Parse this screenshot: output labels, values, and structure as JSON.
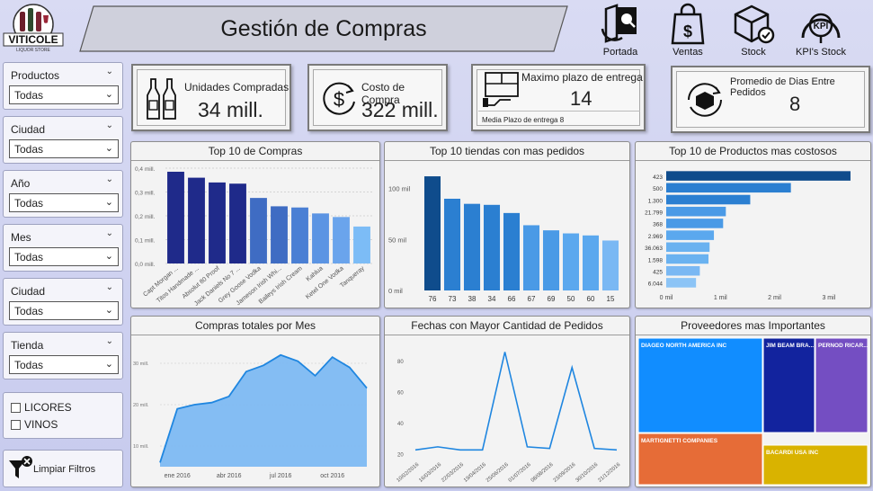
{
  "header": {
    "logo_text": "VITICOLE",
    "logo_sub": "LIQUOR STORE",
    "title": "Gestión de Compras",
    "nav": [
      {
        "label": "Portada",
        "icon": "portada-icon"
      },
      {
        "label": "Ventas",
        "icon": "shopping-bag-dollar-icon"
      },
      {
        "label": "Stock",
        "icon": "stock-box-icon"
      },
      {
        "label": "KPI's Stock",
        "icon": "kpi-gauge-icon"
      }
    ]
  },
  "filters": [
    {
      "label": "Productos",
      "value": "Todas"
    },
    {
      "label": "Ciudad",
      "value": "Todas"
    },
    {
      "label": "Año",
      "value": "Todas"
    },
    {
      "label": "Mes",
      "value": "Todas"
    },
    {
      "label": "Ciudad",
      "value": "Todas"
    },
    {
      "label": "Tienda",
      "value": "Todas"
    }
  ],
  "checkboxes": [
    {
      "label": "LICORES",
      "checked": false
    },
    {
      "label": "VINOS",
      "checked": false
    }
  ],
  "clear_filters": "Limpiar Filtros",
  "kpis": {
    "units": {
      "label": "Unidades Compradas",
      "value": "34 mill."
    },
    "cost": {
      "label": "Costo de Compra",
      "value": "322 mill."
    },
    "max_term": {
      "label": "Maximo plazo de entrega",
      "value": "14",
      "sub": "Media Plazo de entrega 8"
    },
    "avg_days": {
      "label": "Promedio de Dias Entre Pedidos",
      "value": "8"
    }
  },
  "panels": {
    "top_compras": "Top 10 de Compras",
    "top_tiendas": "Top 10 tiendas con mas pedidos",
    "top_productos": "Top 10 de Productos mas costosos",
    "compras_mes": "Compras totales por Mes",
    "fechas": "Fechas con Mayor Cantidad de Pedidos",
    "proveedores": "Proveedores mas Importantes"
  },
  "chart_data": [
    {
      "type": "bar",
      "title": "Top 10 de Compras",
      "categories": [
        "Capt Morgan ...",
        "Titos Handmade ...",
        "Absolut 80 Proof",
        "Jack Daniels No 7 ...",
        "Grey Goose Vodka",
        "Jameson Irish Whi...",
        "Baileys Irish Cream",
        "Kahlua",
        "Ketel One Vodka",
        "Tanqueray"
      ],
      "values": [
        0.385,
        0.36,
        0.34,
        0.335,
        0.275,
        0.24,
        0.235,
        0.21,
        0.195,
        0.155
      ],
      "ylim": [
        0,
        0.4
      ],
      "yticks": [
        "0,0 mill.",
        "0,1 mill.",
        "0,2 mill.",
        "0,3 mill.",
        "0,4 mill."
      ],
      "colors": [
        "#1f2a8a",
        "#1f2a8a",
        "#1f2a8a",
        "#1f2a8a",
        "#3f6cc3",
        "#3f6cc3",
        "#4a7fd4",
        "#5b94e3",
        "#6aa4ec",
        "#7cbcf6"
      ]
    },
    {
      "type": "bar",
      "title": "Top 10 tiendas con mas pedidos",
      "categories": [
        "76",
        "73",
        "38",
        "34",
        "66",
        "67",
        "69",
        "50",
        "60",
        "15"
      ],
      "values": [
        112,
        90,
        85,
        84,
        76,
        64,
        59,
        56,
        54,
        49
      ],
      "ylim": [
        0,
        120
      ],
      "yticks": [
        "0 mil",
        "50 mil",
        "100 mil"
      ],
      "colors": [
        "#0f4c8c",
        "#2b7fd1",
        "#2b7fd1",
        "#2b7fd1",
        "#2b7fd1",
        "#4a9ae6",
        "#4a9ae6",
        "#5ba8ee",
        "#5ba8ee",
        "#7ab8f3"
      ]
    },
    {
      "type": "bar",
      "orientation": "horizontal",
      "title": "Top 10 de Productos mas costosos",
      "categories": [
        "423",
        "500",
        "1.300",
        "21.799",
        "368",
        "2.969",
        "36.063",
        "1.598",
        "425",
        "6.044"
      ],
      "values": [
        3.4,
        2.3,
        1.55,
        1.1,
        1.05,
        0.88,
        0.8,
        0.78,
        0.62,
        0.55
      ],
      "xlim": [
        0,
        3.5
      ],
      "xticks": [
        "0 mil",
        "1 mil",
        "2 mil",
        "3 mil"
      ],
      "colors": [
        "#0f4c8c",
        "#2b7fd1",
        "#2b7fd1",
        "#4a9ae6",
        "#4a9ae6",
        "#5ba8ee",
        "#6ab2f0",
        "#6ab2f0",
        "#7ab8f3",
        "#8cc4f6"
      ]
    },
    {
      "type": "area",
      "title": "Compras totales por Mes",
      "values": [
        6,
        19,
        20,
        20.5,
        22,
        28,
        29.5,
        32,
        30.5,
        27,
        31.5,
        29,
        24
      ],
      "ylim": [
        5,
        35
      ],
      "yticks": [
        "10 mill.",
        "20 mill.",
        "30 mill."
      ],
      "xticks": [
        "ene 2016",
        "abr 2016",
        "jul 2016",
        "oct 2016"
      ]
    },
    {
      "type": "line",
      "title": "Fechas con Mayor Cantidad de Pedidos",
      "x": [
        "10/02/2016",
        "16/03/2016",
        "22/03/2016",
        "19/04/2016",
        "25/06/2016",
        "01/07/2016",
        "08/08/2016",
        "23/09/2016",
        "30/10/2016",
        "21/12/2016"
      ],
      "values": [
        23,
        25,
        23,
        23,
        86,
        25,
        24,
        76,
        24,
        23
      ],
      "ylim": [
        18,
        92
      ],
      "yticks": [
        "20",
        "40",
        "60",
        "80"
      ]
    },
    {
      "type": "treemap",
      "title": "Proveedores mas Importantes",
      "items": [
        {
          "name": "DIAGEO NORTH AMERICA INC",
          "color": "#118dff"
        },
        {
          "name": "JIM BEAM BRA...",
          "color": "#12239e"
        },
        {
          "name": "PERNOD RICAR...",
          "color": "#744ec2"
        },
        {
          "name": "MARTIGNETTI COMPANIES",
          "color": "#e66c37"
        },
        {
          "name": "BACARDI USA INC",
          "color": "#d9b300"
        }
      ]
    }
  ]
}
